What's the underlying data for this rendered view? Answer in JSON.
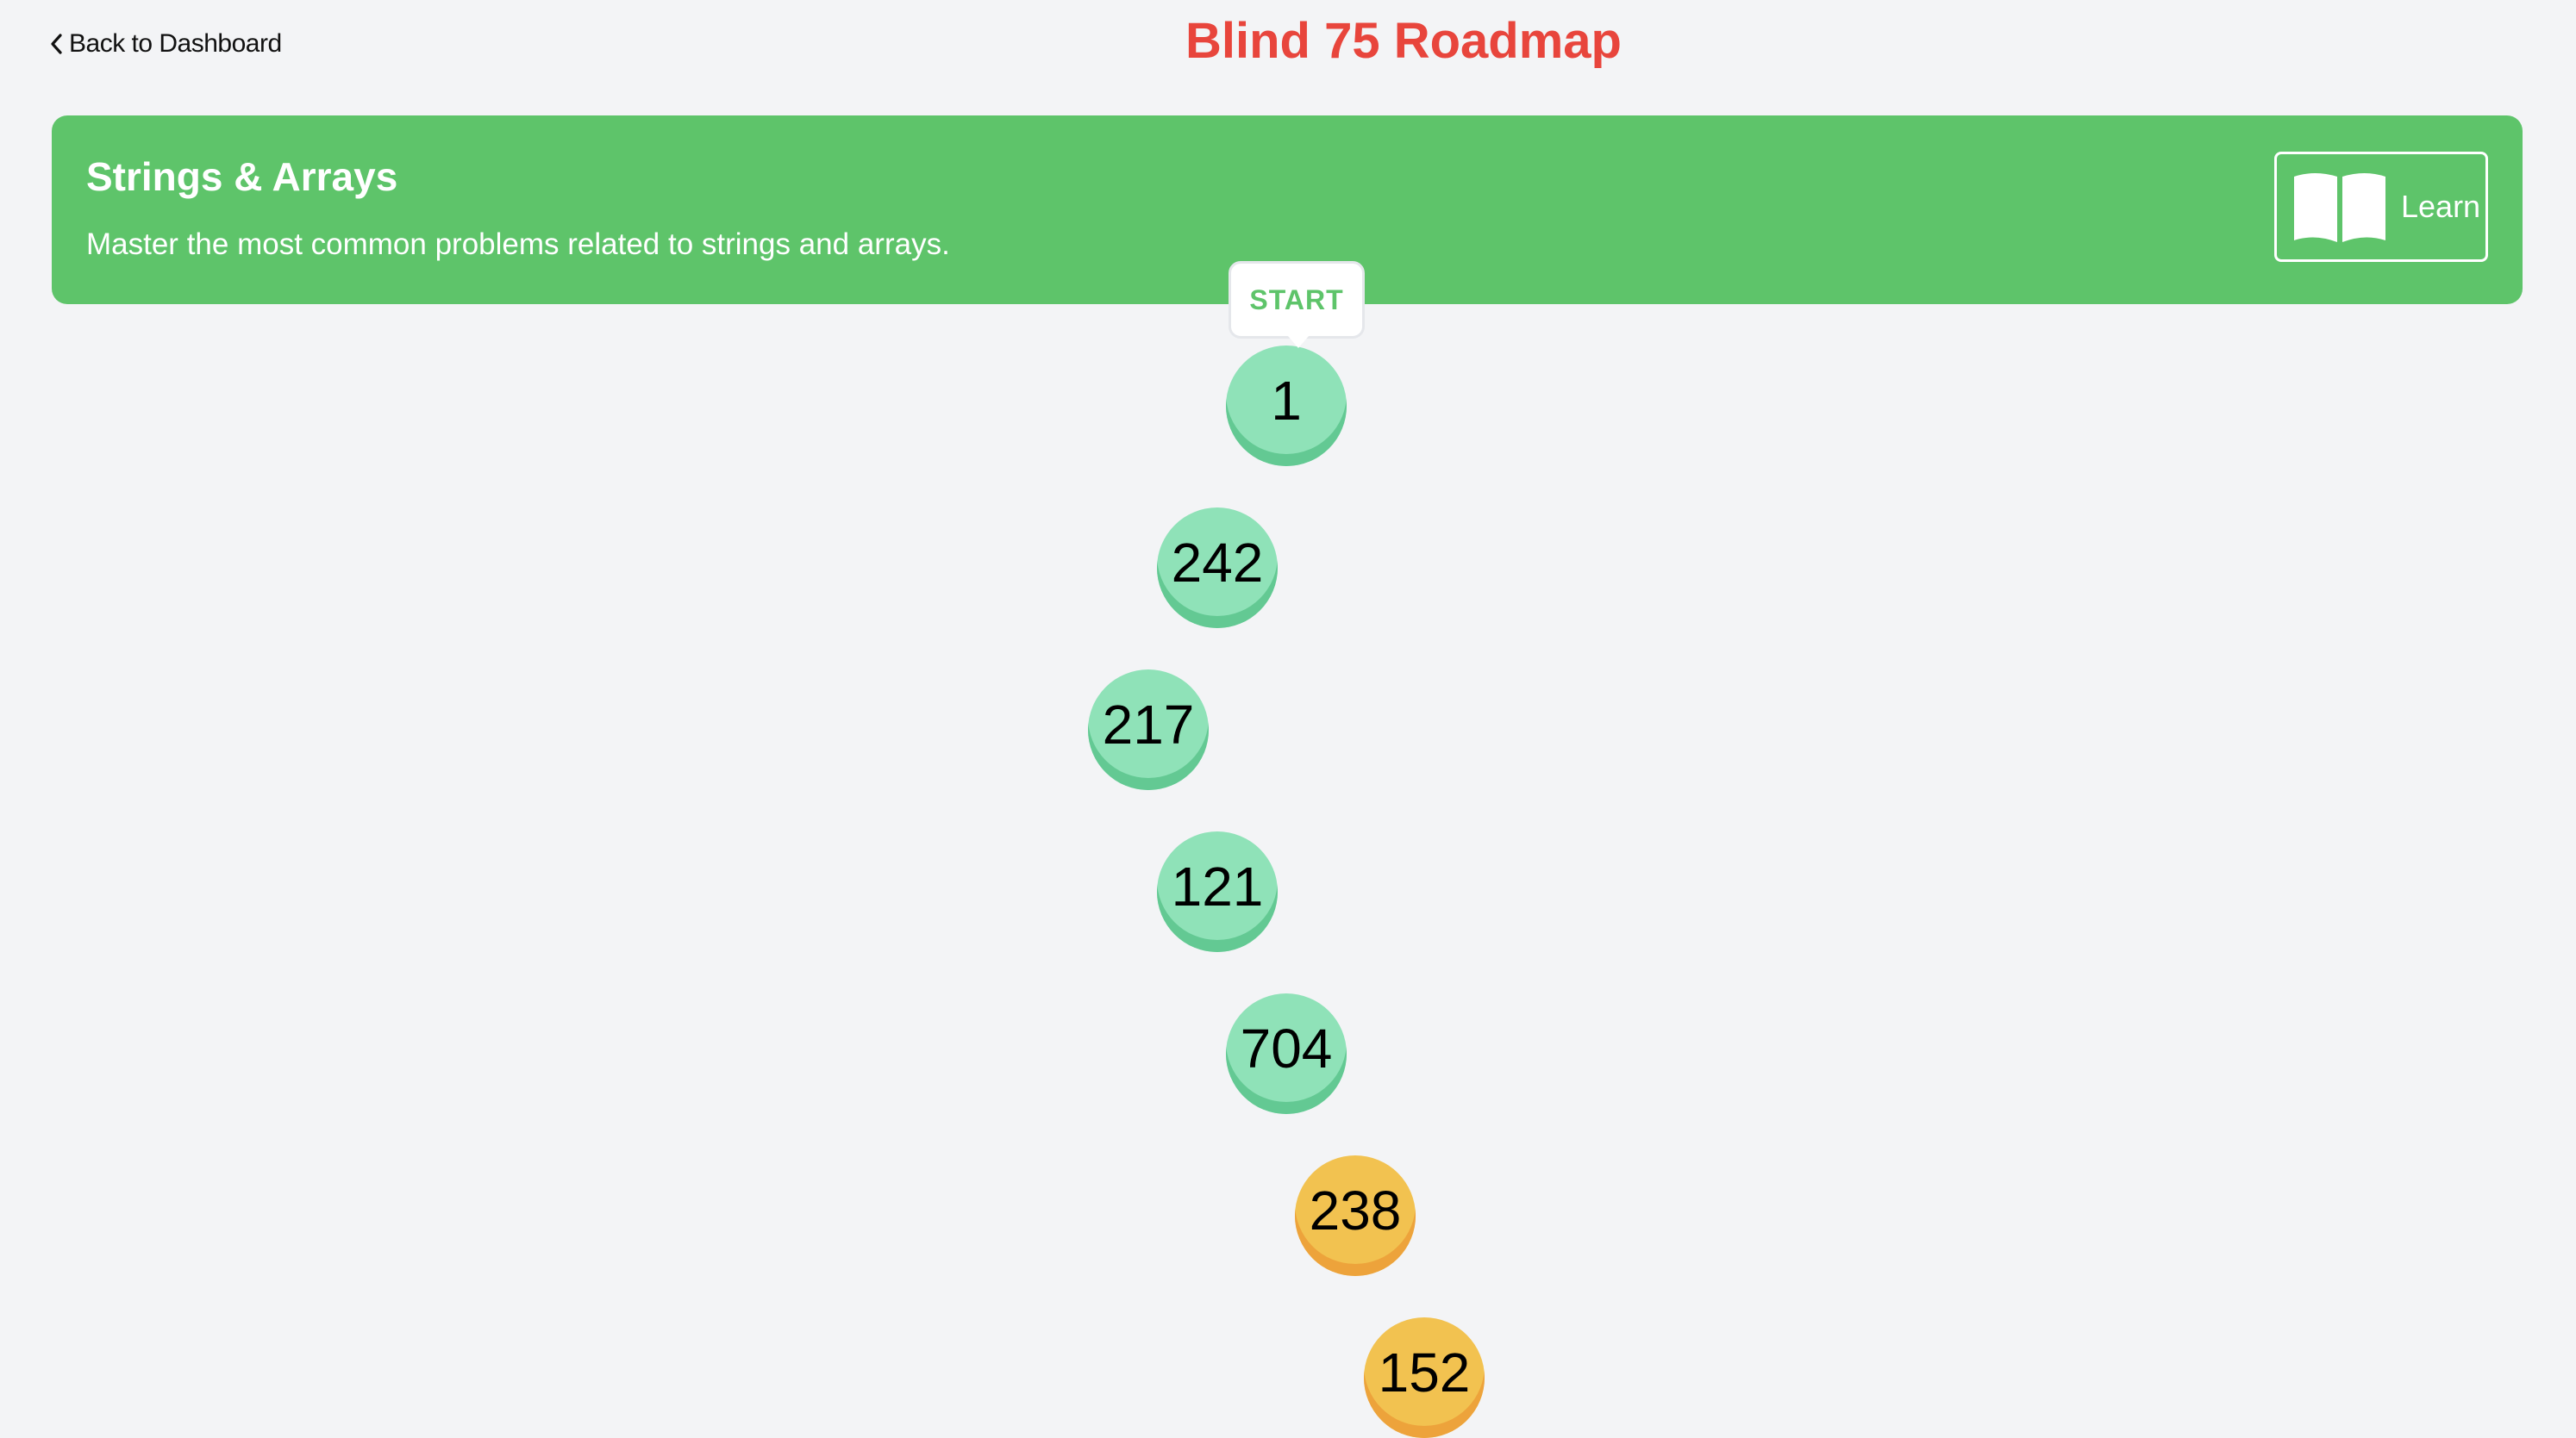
{
  "header": {
    "back_label": "Back to Dashboard",
    "title": "Blind 75 Roadmap"
  },
  "section": {
    "title": "Strings & Arrays",
    "description": "Master the most common problems related to strings and arrays.",
    "learn_label": "Learn"
  },
  "path": {
    "start_label": "START",
    "nodes": [
      {
        "number": "1",
        "difficulty": "easy"
      },
      {
        "number": "242",
        "difficulty": "easy"
      },
      {
        "number": "217",
        "difficulty": "easy"
      },
      {
        "number": "121",
        "difficulty": "easy"
      },
      {
        "number": "704",
        "difficulty": "easy"
      },
      {
        "number": "238",
        "difficulty": "medium"
      },
      {
        "number": "152",
        "difficulty": "medium"
      }
    ]
  },
  "colors": {
    "title": "#e8453c",
    "banner": "#5ec46a",
    "easy": "#8fe2b8",
    "medium": "#f2c250",
    "background": "#f3f4f6"
  }
}
